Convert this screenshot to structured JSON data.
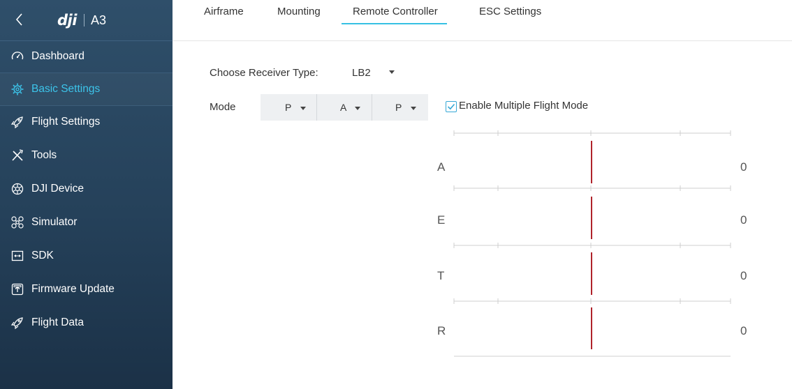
{
  "app": {
    "brand": "dji",
    "model": "A3"
  },
  "sidebar": {
    "items": [
      {
        "label": "Dashboard",
        "icon": "gauge-icon",
        "active": false
      },
      {
        "label": "Basic Settings",
        "icon": "gear-icon",
        "active": true
      },
      {
        "label": "Flight Settings",
        "icon": "rocket-icon",
        "active": false
      },
      {
        "label": "Tools",
        "icon": "tools-icon",
        "active": false
      },
      {
        "label": "DJI Device",
        "icon": "device-icon",
        "active": false
      },
      {
        "label": "Simulator",
        "icon": "drone-icon",
        "active": false
      },
      {
        "label": "SDK",
        "icon": "sdk-icon",
        "active": false
      },
      {
        "label": "Firmware Update",
        "icon": "firmware-icon",
        "active": false
      },
      {
        "label": "Flight Data",
        "icon": "rocket-icon",
        "active": false
      }
    ]
  },
  "tabs": [
    {
      "label": "Airframe",
      "active": false
    },
    {
      "label": "Mounting",
      "active": false
    },
    {
      "label": "Remote Controller",
      "active": true
    },
    {
      "label": "ESC Settings",
      "active": false
    }
  ],
  "receiver": {
    "label": "Choose Receiver Type:",
    "value": "LB2"
  },
  "mode": {
    "label": "Mode",
    "options": [
      "P",
      "A",
      "P"
    ]
  },
  "multi_mode": {
    "label": "Enable Multiple Flight Mode",
    "checked": true
  },
  "channels": [
    {
      "name": "A",
      "value": "0"
    },
    {
      "name": "E",
      "value": "0"
    },
    {
      "name": "T",
      "value": "0"
    },
    {
      "name": "R",
      "value": "0"
    }
  ],
  "colors": {
    "accent": "#36c0e3",
    "indicator": "#b0232b",
    "sidebar": "#25415a"
  }
}
